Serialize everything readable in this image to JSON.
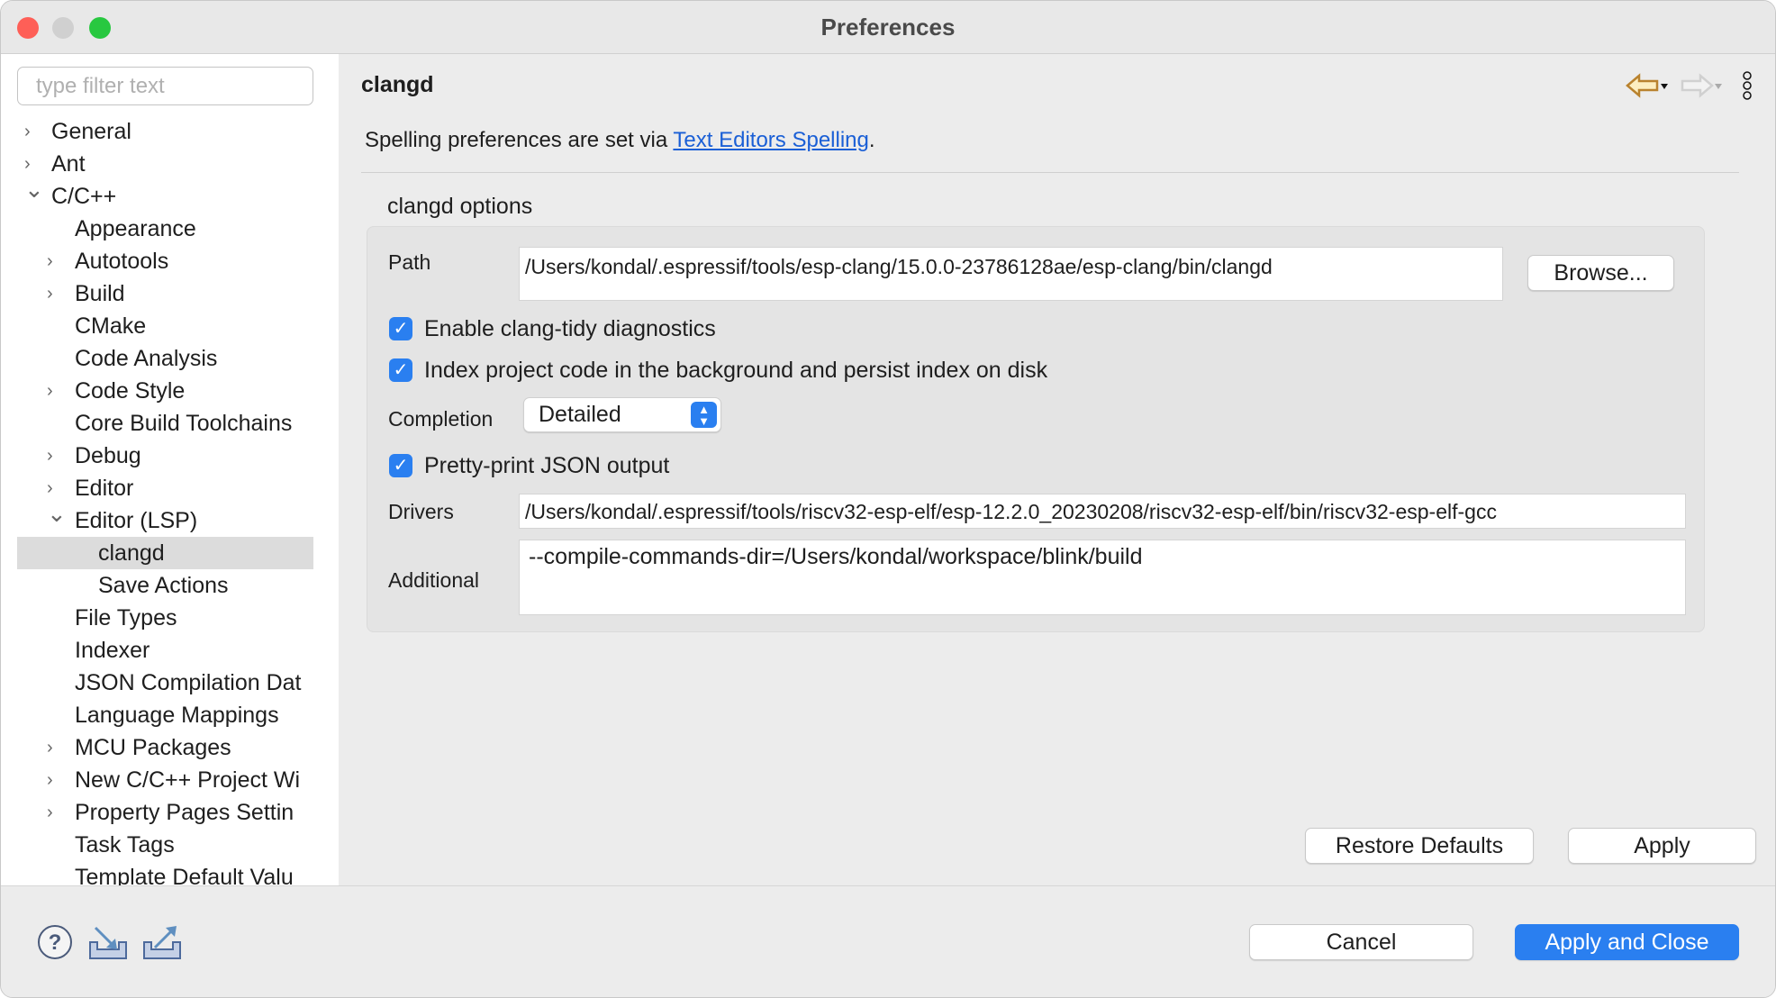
{
  "window": {
    "title": "Preferences"
  },
  "sidebar": {
    "filter_placeholder": "type filter text",
    "items": [
      {
        "label": "General",
        "level": 0,
        "chevron": "right"
      },
      {
        "label": "Ant",
        "level": 0,
        "chevron": "right"
      },
      {
        "label": "C/C++",
        "level": 0,
        "chevron": "down"
      },
      {
        "label": "Appearance",
        "level": 1,
        "chevron": ""
      },
      {
        "label": "Autotools",
        "level": 1,
        "chevron": "right"
      },
      {
        "label": "Build",
        "level": 1,
        "chevron": "right"
      },
      {
        "label": "CMake",
        "level": 1,
        "chevron": ""
      },
      {
        "label": "Code Analysis",
        "level": 1,
        "chevron": ""
      },
      {
        "label": "Code Style",
        "level": 1,
        "chevron": "right"
      },
      {
        "label": "Core Build Toolchains",
        "level": 1,
        "chevron": ""
      },
      {
        "label": "Debug",
        "level": 1,
        "chevron": "right"
      },
      {
        "label": "Editor",
        "level": 1,
        "chevron": "right"
      },
      {
        "label": "Editor (LSP)",
        "level": 1,
        "chevron": "down"
      },
      {
        "label": "clangd",
        "level": 2,
        "chevron": "",
        "selected": true
      },
      {
        "label": "Save Actions",
        "level": 2,
        "chevron": ""
      },
      {
        "label": "File Types",
        "level": 1,
        "chevron": ""
      },
      {
        "label": "Indexer",
        "level": 1,
        "chevron": ""
      },
      {
        "label": "JSON Compilation Dat",
        "level": 1,
        "chevron": ""
      },
      {
        "label": "Language Mappings",
        "level": 1,
        "chevron": ""
      },
      {
        "label": "MCU Packages",
        "level": 1,
        "chevron": "right"
      },
      {
        "label": "New C/C++ Project Wi",
        "level": 1,
        "chevron": "right"
      },
      {
        "label": "Property Pages Settin",
        "level": 1,
        "chevron": "right"
      },
      {
        "label": "Task Tags",
        "level": 1,
        "chevron": ""
      },
      {
        "label": "Template Default Valu",
        "level": 1,
        "chevron": ""
      }
    ]
  },
  "main": {
    "title": "clangd",
    "spelling_prefix": "Spelling preferences are set via ",
    "spelling_link": "Text Editors Spelling",
    "spelling_suffix": ".",
    "group_title": "clangd options",
    "path_label": "Path",
    "path_value": "/Users/kondal/.espressif/tools/esp-clang/15.0.0-23786128ae/esp-clang/bin/clangd",
    "browse": "Browse...",
    "clang_tidy": "Enable clang-tidy diagnostics",
    "clang_tidy_checked": true,
    "index": "Index project code in the background and persist index on disk",
    "index_checked": true,
    "completion_label": "Completion",
    "completion_value": "Detailed",
    "pretty": "Pretty-print JSON output",
    "pretty_checked": true,
    "drivers_label": "Drivers",
    "drivers_value": "/Users/kondal/.espressif/tools/riscv32-esp-elf/esp-12.2.0_20230208/riscv32-esp-elf/bin/riscv32-esp-elf-gcc",
    "additional_label": "Additional",
    "additional_value": "--compile-commands-dir=/Users/kondal/workspace/blink/build",
    "restore": "Restore Defaults",
    "apply": "Apply"
  },
  "footer": {
    "cancel": "Cancel",
    "apply_close": "Apply and Close"
  },
  "colors": {
    "accent": "#2a7ff0",
    "link": "#1a5fd6"
  }
}
